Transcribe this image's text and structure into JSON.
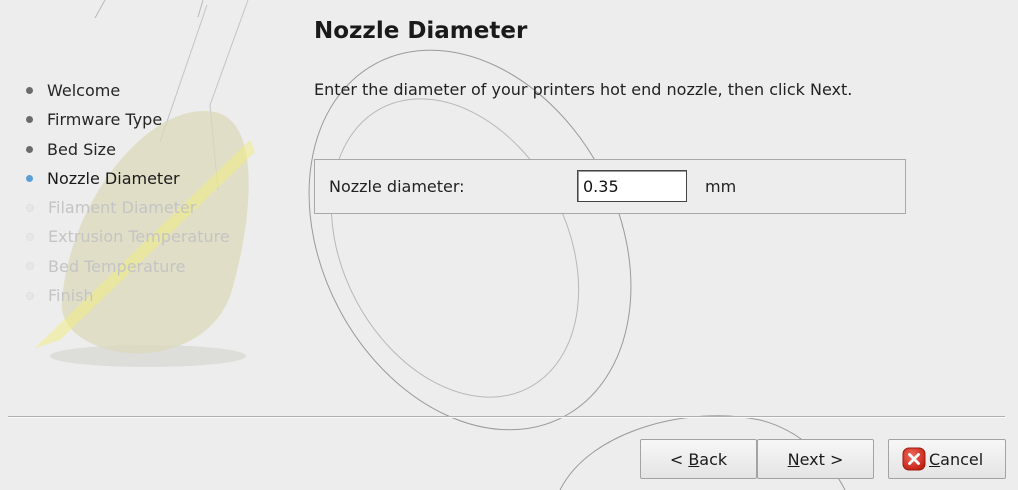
{
  "wizard": {
    "steps": [
      {
        "label": "Welcome",
        "state": "done"
      },
      {
        "label": "Firmware Type",
        "state": "done"
      },
      {
        "label": "Bed Size",
        "state": "done"
      },
      {
        "label": "Nozzle Diameter",
        "state": "current"
      },
      {
        "label": "Filament Diameter",
        "state": "todo"
      },
      {
        "label": "Extrusion Temperature",
        "state": "todo"
      },
      {
        "label": "Bed Temperature",
        "state": "todo"
      },
      {
        "label": "Finish",
        "state": "todo"
      }
    ]
  },
  "page": {
    "title": "Nozzle Diameter",
    "description": "Enter the diameter of your printers hot end nozzle, then click Next."
  },
  "form": {
    "label": "Nozzle diameter:",
    "value": "0.35",
    "unit": "mm"
  },
  "buttons": {
    "back": {
      "prefix": "< ",
      "mnemonic": "B",
      "rest": "ack"
    },
    "next": {
      "prefix": "",
      "mnemonic": "N",
      "rest": "ext >"
    },
    "cancel": {
      "prefix": "",
      "mnemonic": "C",
      "rest": "ancel"
    }
  },
  "icons": {
    "cancel": "cancel-icon"
  },
  "colors": {
    "current_step_bullet": "#5a9fd8",
    "cancel_icon": "#d42a1c"
  }
}
